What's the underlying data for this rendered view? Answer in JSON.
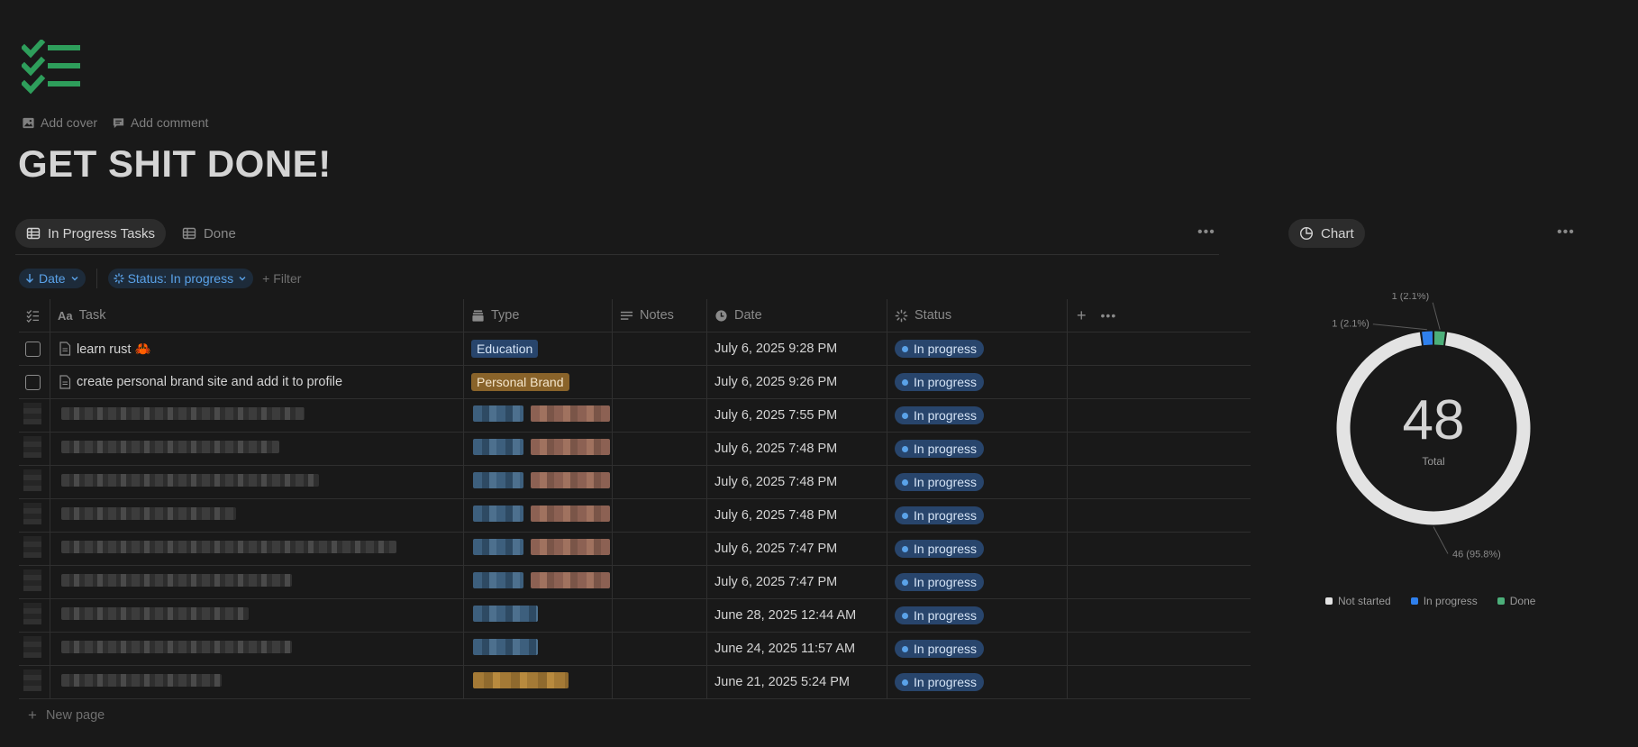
{
  "page": {
    "icon": "checklist-icon",
    "add_cover": "Add cover",
    "add_comment": "Add comment",
    "title": "GET SHIT DONE!"
  },
  "tabs": [
    {
      "label": "In Progress Tasks",
      "icon": "table-icon",
      "active": true
    },
    {
      "label": "Done",
      "icon": "table-icon",
      "active": false
    }
  ],
  "filters": {
    "sort": "Date",
    "status": "Status: In progress",
    "add": "Filter"
  },
  "columns": {
    "task": "Task",
    "type": "Type",
    "notes": "Notes",
    "date": "Date",
    "status": "Status"
  },
  "rows": [
    {
      "task": "learn rust 🦀",
      "type": "Education",
      "date": "July 6, 2025 9:28 PM",
      "status": "In progress"
    },
    {
      "task": "create personal brand site and add it to profile",
      "type": "Personal Brand",
      "date": "July 6, 2025 9:26 PM",
      "status": "In progress"
    },
    {
      "date": "July 6, 2025 7:55 PM",
      "status": "In progress"
    },
    {
      "date": "July 6, 2025 7:48 PM",
      "status": "In progress"
    },
    {
      "date": "July 6, 2025 7:48 PM",
      "status": "In progress"
    },
    {
      "date": "July 6, 2025 7:48 PM",
      "status": "In progress"
    },
    {
      "date": "July 6, 2025 7:47 PM",
      "status": "In progress"
    },
    {
      "date": "July 6, 2025 7:47 PM",
      "status": "In progress"
    },
    {
      "date": "June 28, 2025 12:44 AM",
      "status": "In progress"
    },
    {
      "date": "June 24, 2025 11:57 AM",
      "status": "In progress"
    },
    {
      "date": "June 21, 2025 5:24 PM",
      "status": "In progress"
    }
  ],
  "new_page": "New page",
  "chart_view": {
    "label": "Chart"
  },
  "chart_data": {
    "type": "pie",
    "center_value": "48",
    "center_label": "Total",
    "slices": [
      {
        "name": "Not started",
        "value": 46,
        "label": "46 (95.8%)",
        "color": "#e3e3e3"
      },
      {
        "name": "In progress",
        "value": 1,
        "label": "1 (2.1%)",
        "color": "#2f80ed"
      },
      {
        "name": "Done",
        "value": 1,
        "label": "1 (2.1%)",
        "color": "#4caf7a"
      }
    ],
    "legend": [
      "Not started",
      "In progress",
      "Done"
    ]
  },
  "colors": {
    "accent": "#5aa2e8",
    "in_progress_bg": "#28456c",
    "education_tag": "#28456c",
    "personal_brand_tag": "#89632a",
    "icon_green": "#2e9e5b"
  }
}
